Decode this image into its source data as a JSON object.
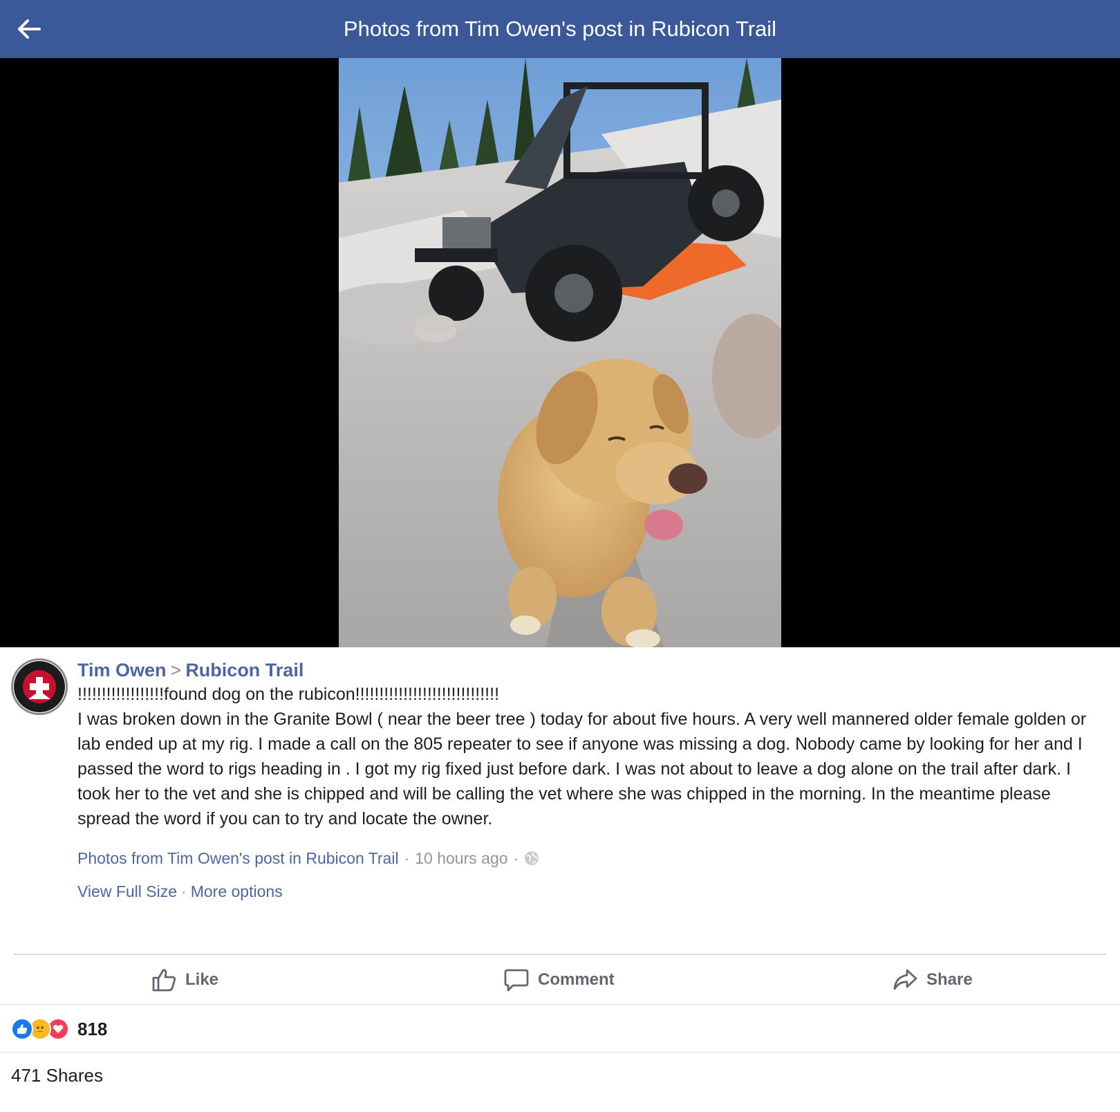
{
  "header": {
    "title": "Photos from Tim Owen's post in Rubicon Trail",
    "back_icon": "arrow-left-icon"
  },
  "photo": {
    "description_icon": "photo"
  },
  "post": {
    "author": "Tim Owen",
    "separator": ">",
    "group": "Rubicon Trail",
    "headline": "!!!!!!!!!!!!!!!!!!found dog on the rubicon!!!!!!!!!!!!!!!!!!!!!!!!!!!!!!",
    "body": "I was broken down in the Granite Bowl ( near the beer tree ) today for about five hours. A very well mannered older female golden or lab ended up at my rig. I made a call on the 805 repeater to see if anyone was missing a dog. Nobody came by looking for her and I passed the word to rigs heading in . I got my rig fixed just before dark. I was not about to leave a dog alone on the trail after dark. I took her to the vet and she is chipped and will be calling the vet where she was chipped in the morning. In the meantime please spread the word if you can to try and locate the owner.",
    "meta_link": "Photos from Tim Owen's post in Rubicon Trail",
    "meta_dot": "·",
    "timestamp": "10 hours ago",
    "privacy_icon": "globe-icon",
    "view_full_size": "View Full Size",
    "more_options": "More options"
  },
  "actions": {
    "like": "Like",
    "comment": "Comment",
    "share": "Share"
  },
  "stats": {
    "reaction_count": "818",
    "shares": "471 Shares"
  },
  "colors": {
    "header_bg": "#3b5998",
    "link": "#4b67a1",
    "muted": "#90949c",
    "like_blue": "#1877f2",
    "love_red": "#f33e58",
    "care_yellow": "#f7b928"
  }
}
